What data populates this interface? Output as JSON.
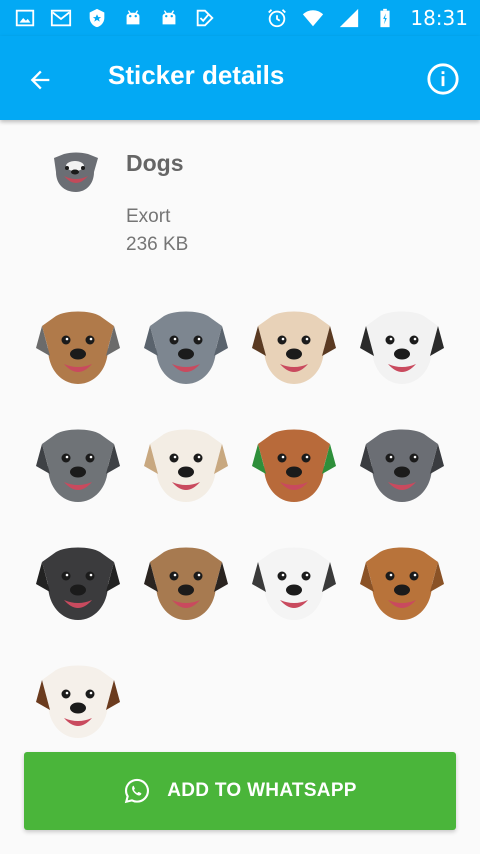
{
  "status_bar": {
    "time": "18:31",
    "icons": [
      "image-icon",
      "gmail-icon",
      "shield-icon",
      "android-icon",
      "android-icon",
      "check-icon",
      "alarm-icon",
      "wifi-icon",
      "signal-icon",
      "battery-icon"
    ]
  },
  "app_bar": {
    "title": "Sticker details",
    "back_icon": "arrow-back-icon",
    "info_icon": "info-icon"
  },
  "pack": {
    "name": "Dogs",
    "author": "Exort",
    "size": "236 KB"
  },
  "stickers": [
    {
      "name": "dog-headphones",
      "fur": "#b07a4a",
      "accent": "#6b6b6b"
    },
    {
      "name": "grey-dog",
      "fur": "#7d8690",
      "accent": "#5a636d"
    },
    {
      "name": "eyebrow-dog",
      "fur": "#e8d2b8",
      "accent": "#5a3a22"
    },
    {
      "name": "dalmatian-dog",
      "fur": "#f2f2f2",
      "accent": "#2a2a2a"
    },
    {
      "name": "grey-pup",
      "fur": "#6f7377",
      "accent": "#3e4145"
    },
    {
      "name": "whippet-dog",
      "fur": "#f3ede4",
      "accent": "#c8a880"
    },
    {
      "name": "pumpkin-dog",
      "fur": "#b86a3a",
      "accent": "#2e8f3a"
    },
    {
      "name": "staffy-dog",
      "fur": "#6b6e74",
      "accent": "#3a3c40"
    },
    {
      "name": "black-staffy",
      "fur": "#3b3b3d",
      "accent": "#222"
    },
    {
      "name": "great-dane",
      "fur": "#a77a50",
      "accent": "#2a2420"
    },
    {
      "name": "husky-dog",
      "fur": "#f4f4f4",
      "accent": "#3a3a3a"
    },
    {
      "name": "vizsla-dog",
      "fur": "#b8733a",
      "accent": "#8a5226"
    },
    {
      "name": "spaniel-dog",
      "fur": "#f5f0ea",
      "accent": "#6b3b1e"
    }
  ],
  "add_button": {
    "label": "ADD TO WHATSAPP",
    "icon": "whatsapp-icon",
    "color": "#4ab53a"
  },
  "colors": {
    "primary": "#03a9f4",
    "background": "#fafafa"
  }
}
